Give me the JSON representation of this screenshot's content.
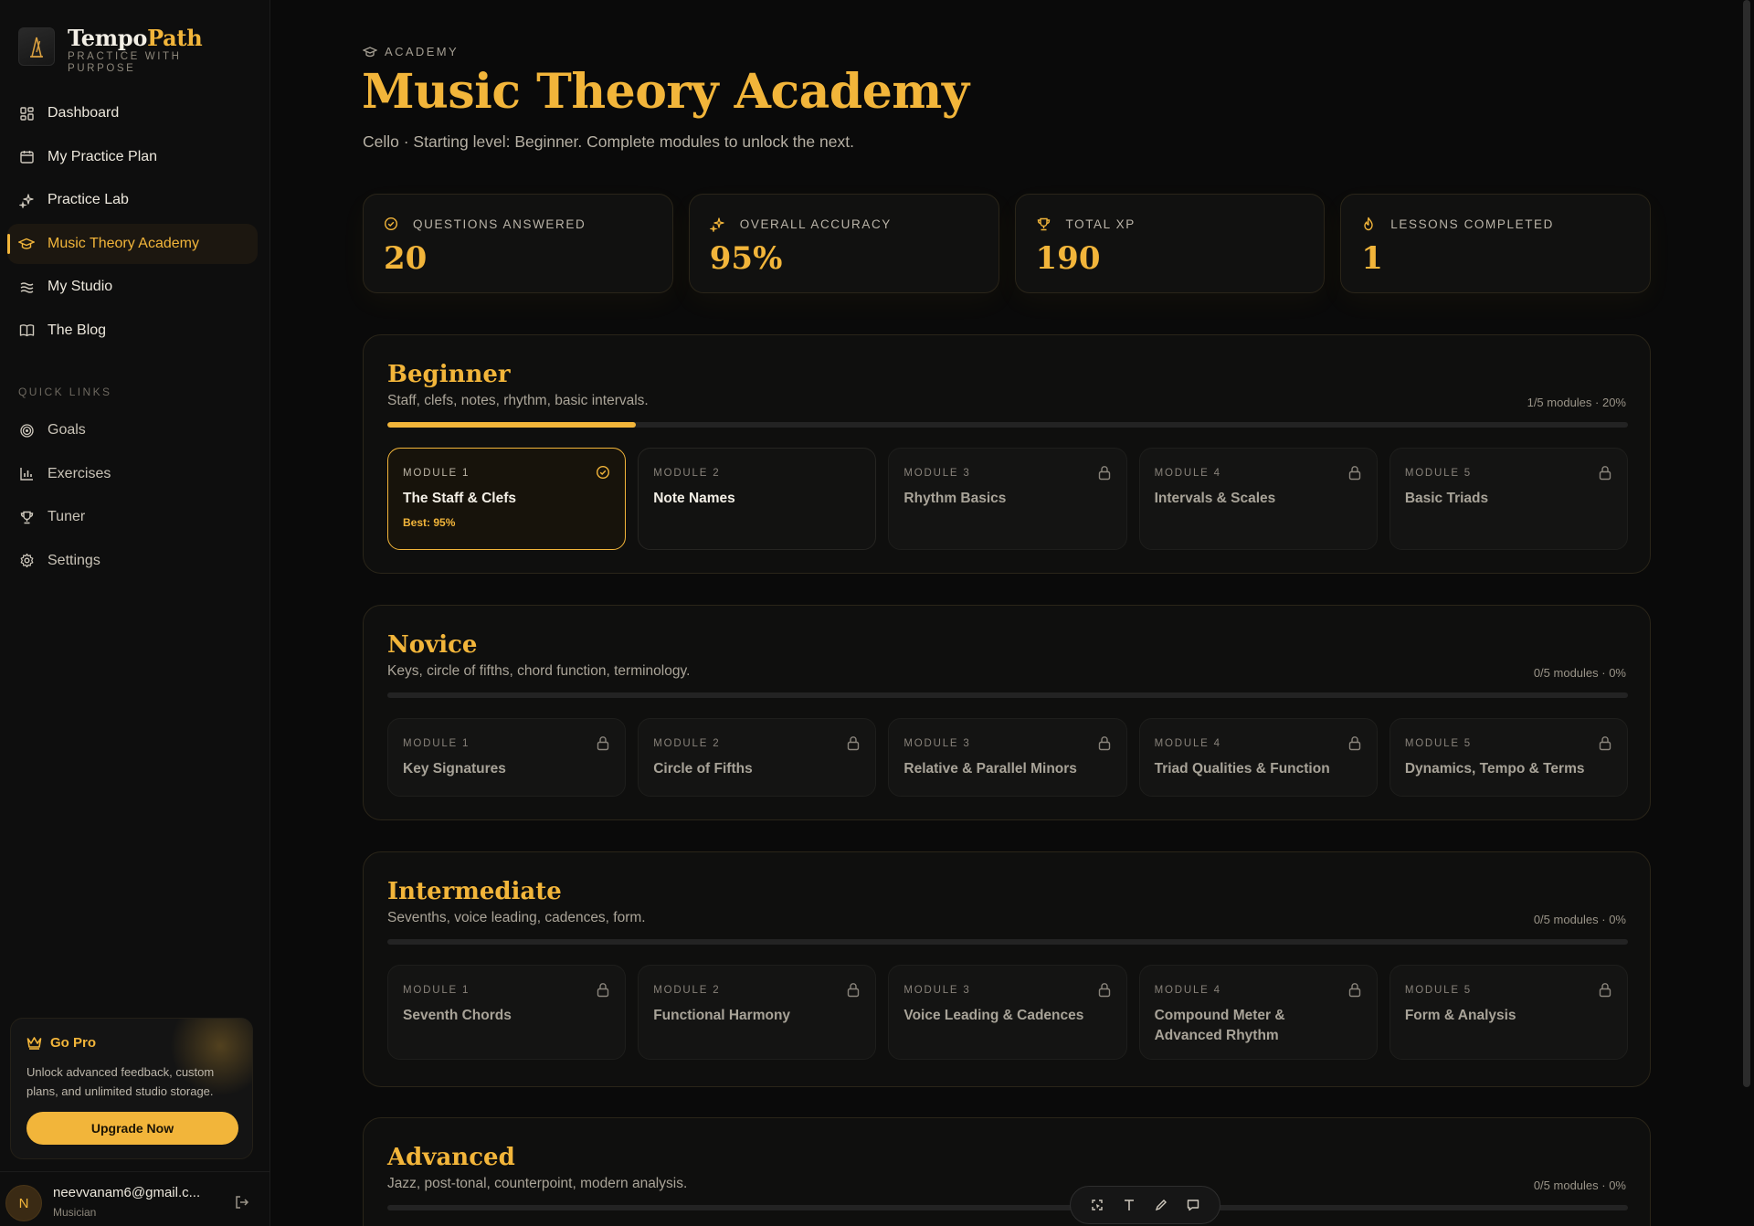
{
  "sidebar": {
    "brand_name_a": "Tempo",
    "brand_name_b": "Path",
    "brand_tag": "PRACTICE WITH PURPOSE",
    "nav": [
      {
        "label": "Dashboard",
        "icon": "dashboard-icon"
      },
      {
        "label": "My Practice Plan",
        "icon": "calendar-icon"
      },
      {
        "label": "Practice Lab",
        "icon": "sparkle-icon"
      },
      {
        "label": "Music Theory Academy",
        "icon": "graduation-cap-icon",
        "active": true
      },
      {
        "label": "My Studio",
        "icon": "waves-icon"
      },
      {
        "label": "The Blog",
        "icon": "book-icon"
      }
    ],
    "quick_links_title": "QUICK LINKS",
    "quick_links": [
      {
        "label": "Goals",
        "icon": "target-icon"
      },
      {
        "label": "Exercises",
        "icon": "bar-chart-icon"
      },
      {
        "label": "Tuner",
        "icon": "trophy-icon"
      },
      {
        "label": "Settings",
        "icon": "gear-icon"
      }
    ],
    "pro": {
      "title": "Go Pro",
      "text": "Unlock advanced feedback, custom plans, and unlimited studio storage.",
      "button": "Upgrade Now"
    },
    "user": {
      "initial": "N",
      "email": "neevvanam6@gmail.c...",
      "role": "Musician"
    }
  },
  "header": {
    "eyebrow": "ACADEMY",
    "title": "Music Theory Academy",
    "subtitle": "Cello · Starting level: Beginner. Complete modules to unlock the next."
  },
  "stats": [
    {
      "label": "QUESTIONS ANSWERED",
      "value": "20",
      "icon": "check-circle-icon"
    },
    {
      "label": "OVERALL ACCURACY",
      "value": "95%",
      "icon": "sparkle-icon"
    },
    {
      "label": "TOTAL XP",
      "value": "190",
      "icon": "trophy-icon"
    },
    {
      "label": "LESSONS COMPLETED",
      "value": "1",
      "icon": "flame-icon"
    }
  ],
  "levels": [
    {
      "title": "Beginner",
      "desc": "Staff, clefs, notes, rhythm, basic intervals.",
      "meta": "1/5 modules · 20%",
      "progress": 0.2,
      "modules": [
        {
          "num": "MODULE 1",
          "title": "The Staff & Clefs",
          "state": "done",
          "best": "Best: 95%"
        },
        {
          "num": "MODULE 2",
          "title": "Note Names",
          "state": "open"
        },
        {
          "num": "MODULE 3",
          "title": "Rhythm Basics",
          "state": "locked"
        },
        {
          "num": "MODULE 4",
          "title": "Intervals & Scales",
          "state": "locked"
        },
        {
          "num": "MODULE 5",
          "title": "Basic Triads",
          "state": "locked"
        }
      ]
    },
    {
      "title": "Novice",
      "desc": "Keys, circle of fifths, chord function, terminology.",
      "meta": "0/5 modules · 0%",
      "progress": 0,
      "modules": [
        {
          "num": "MODULE 1",
          "title": "Key Signatures",
          "state": "locked"
        },
        {
          "num": "MODULE 2",
          "title": "Circle of Fifths",
          "state": "locked"
        },
        {
          "num": "MODULE 3",
          "title": "Relative & Parallel Minors",
          "state": "locked"
        },
        {
          "num": "MODULE 4",
          "title": "Triad Qualities & Function",
          "state": "locked"
        },
        {
          "num": "MODULE 5",
          "title": "Dynamics, Tempo & Terms",
          "state": "locked"
        }
      ]
    },
    {
      "title": "Intermediate",
      "desc": "Sevenths, voice leading, cadences, form.",
      "meta": "0/5 modules · 0%",
      "progress": 0,
      "modules": [
        {
          "num": "MODULE 1",
          "title": "Seventh Chords",
          "state": "locked"
        },
        {
          "num": "MODULE 2",
          "title": "Functional Harmony",
          "state": "locked"
        },
        {
          "num": "MODULE 3",
          "title": "Voice Leading & Cadences",
          "state": "locked"
        },
        {
          "num": "MODULE 4",
          "title": "Compound Meter & Advanced Rhythm",
          "state": "locked"
        },
        {
          "num": "MODULE 5",
          "title": "Form & Analysis",
          "state": "locked"
        }
      ]
    },
    {
      "title": "Advanced",
      "desc": "Jazz, post-tonal, counterpoint, modern analysis.",
      "meta": "0/5 modules · 0%",
      "progress": 0,
      "modules": []
    }
  ],
  "toolbar": [
    {
      "icon": "select-icon"
    },
    {
      "icon": "text-icon"
    },
    {
      "icon": "pen-icon"
    },
    {
      "icon": "comment-icon"
    }
  ],
  "colors": {
    "accent": "#f2b53a",
    "background": "#0a0a0a",
    "panel": "#0f0f0e"
  }
}
